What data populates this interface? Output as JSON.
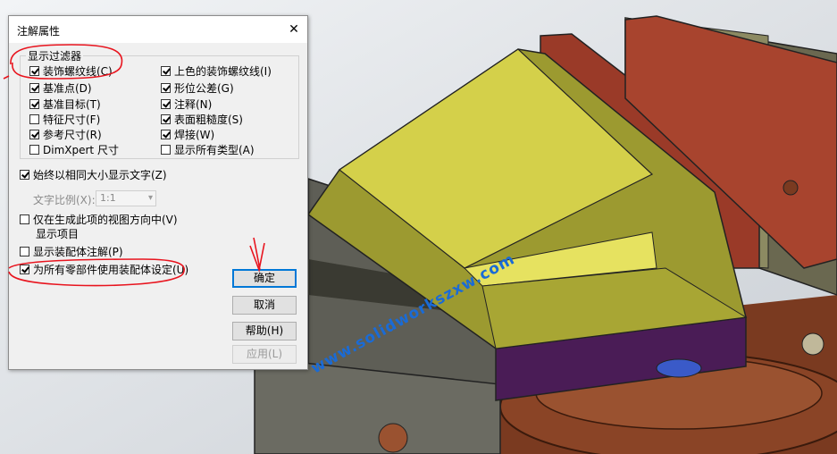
{
  "dialog": {
    "title": "注解属性",
    "close_glyph": "✕",
    "filter_group_label": "显示过滤器",
    "filters_left": [
      {
        "label": "装饰螺纹线(C)",
        "checked": true
      },
      {
        "label": "基准点(D)",
        "checked": true
      },
      {
        "label": "基准目标(T)",
        "checked": true
      },
      {
        "label": "特征尺寸(F)",
        "checked": false
      },
      {
        "label": "参考尺寸(R)",
        "checked": true
      },
      {
        "label": "DimXpert 尺寸",
        "checked": false
      }
    ],
    "filters_right": [
      {
        "label": "上色的装饰螺纹线(I)",
        "checked": true
      },
      {
        "label": "形位公差(G)",
        "checked": true
      },
      {
        "label": "注释(N)",
        "checked": true
      },
      {
        "label": "表面粗糙度(S)",
        "checked": true
      },
      {
        "label": "焊接(W)",
        "checked": true
      },
      {
        "label": "显示所有类型(A)",
        "checked": false
      }
    ],
    "same_size_text": {
      "label": "始终以相同大小显示文字(Z)",
      "checked": true
    },
    "text_scale_label": "文字比例(X):",
    "text_scale_value": "1:1",
    "view_direction": {
      "label_line1": "仅在生成此项的视图方向中(V)",
      "label_line2": "显示项目",
      "checked": false
    },
    "show_assembly_annotations": {
      "label": "显示装配体注解(P)",
      "checked": false
    },
    "use_assembly_settings": {
      "label": "为所有零部件使用装配体设定(U)",
      "checked": true
    },
    "buttons": {
      "ok": "确定",
      "cancel": "取消",
      "help": "帮助(H)",
      "apply": "应用(L)"
    }
  },
  "watermark": "www.solidworkszxw.com",
  "colors": {
    "accent": "#0078d7",
    "annotation": "#e8141e",
    "watermark": "#1a6bd6"
  }
}
